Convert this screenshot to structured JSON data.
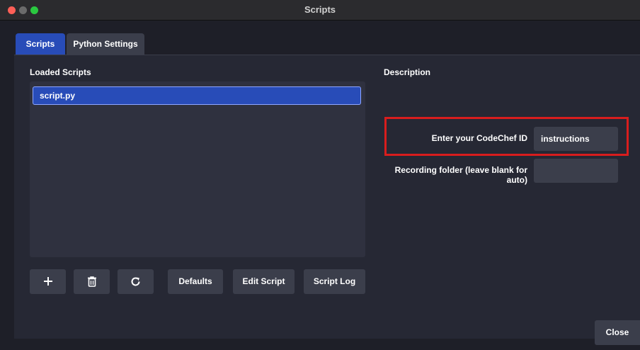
{
  "window": {
    "title": "Scripts"
  },
  "tabs": [
    {
      "label": "Scripts",
      "active": true
    },
    {
      "label": "Python Settings",
      "active": false
    }
  ],
  "loaded_scripts": {
    "heading": "Loaded Scripts",
    "items": [
      {
        "name": "script.py",
        "selected": true
      }
    ]
  },
  "toolbar": {
    "add_icon": "plus-icon",
    "remove_icon": "trash-icon",
    "reload_icon": "refresh-icon",
    "defaults_label": "Defaults",
    "edit_script_label": "Edit Script",
    "script_log_label": "Script Log"
  },
  "description": {
    "heading": "Description"
  },
  "properties": {
    "codechef_id": {
      "label": "Enter your CodeChef ID",
      "value": "instructions"
    },
    "recording_folder": {
      "label": "Recording folder (leave blank for auto)",
      "value": ""
    }
  },
  "footer": {
    "close_label": "Close"
  },
  "colors": {
    "accent": "#284cb8",
    "highlight_border": "#d81d1d",
    "background": "#1e1f28",
    "panel": "#262834",
    "control": "#3b3e4b"
  }
}
